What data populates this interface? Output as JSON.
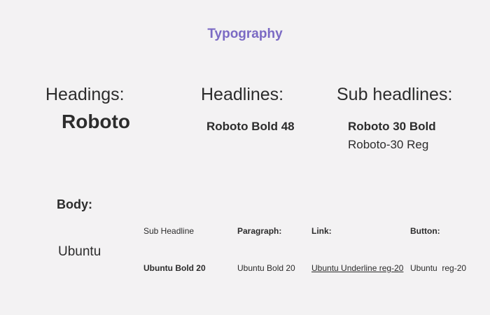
{
  "title": "Typography",
  "headings": {
    "label": "Headings:",
    "font": "Roboto"
  },
  "headlines": {
    "label": "Headlines:",
    "sample": "Roboto Bold 48"
  },
  "subheadlines": {
    "label": "Sub headlines:",
    "sample_bold": "Roboto 30 Bold",
    "sample_regular": "Roboto-30 Reg"
  },
  "body": {
    "label": "Body:",
    "font": "Ubuntu",
    "columns": [
      {
        "header": "Sub Headline",
        "value": "Ubuntu Bold 20"
      },
      {
        "header": "Paragraph:",
        "value": "Ubuntu Bold 20"
      },
      {
        "header": "Link:",
        "value": "Ubuntu Underline reg-20"
      },
      {
        "header": "Button:",
        "value": "Ubuntu  reg-20"
      }
    ]
  },
  "colors": {
    "accent": "#7b6ac4",
    "background": "#f3f2f3",
    "text": "#2c2c2c"
  }
}
